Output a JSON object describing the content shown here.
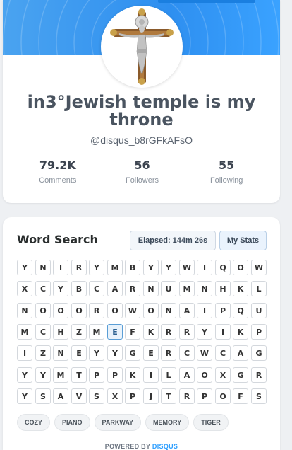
{
  "profile": {
    "display_name": "in3°Jewish temple is my throne",
    "handle": "@disqus_b8rGFkAFsO",
    "stats": [
      {
        "value": "79.2K",
        "label": "Comments"
      },
      {
        "value": "56",
        "label": "Followers"
      },
      {
        "value": "55",
        "label": "Following"
      }
    ]
  },
  "word_search": {
    "title": "Word Search",
    "elapsed": "Elapsed: 144m 26s",
    "my_stats_label": "My Stats",
    "grid": [
      [
        "Y",
        "N",
        "I",
        "R",
        "Y",
        "M",
        "B",
        "Y",
        "Y",
        "W",
        "I",
        "Q",
        "O",
        "W"
      ],
      [
        "X",
        "C",
        "Y",
        "B",
        "C",
        "A",
        "R",
        "N",
        "U",
        "M",
        "N",
        "H",
        "K",
        "L"
      ],
      [
        "N",
        "O",
        "O",
        "O",
        "R",
        "O",
        "W",
        "O",
        "N",
        "A",
        "I",
        "P",
        "Q",
        "U"
      ],
      [
        "M",
        "C",
        "H",
        "Z",
        "M",
        "E",
        "F",
        "K",
        "R",
        "R",
        "Y",
        "I",
        "K",
        "P"
      ],
      [
        "I",
        "Z",
        "N",
        "E",
        "Y",
        "Y",
        "G",
        "E",
        "R",
        "C",
        "W",
        "C",
        "A",
        "G"
      ],
      [
        "Y",
        "Y",
        "M",
        "T",
        "P",
        "P",
        "K",
        "I",
        "L",
        "A",
        "O",
        "X",
        "G",
        "R"
      ],
      [
        "Y",
        "S",
        "A",
        "V",
        "S",
        "X",
        "P",
        "J",
        "T",
        "R",
        "P",
        "O",
        "F",
        "S"
      ]
    ],
    "selected_cell": "E (row 4, column 6)",
    "words": [
      "COZY",
      "PIANO",
      "PARKWAY",
      "MEMORY",
      "TIGER"
    ]
  },
  "footer": {
    "powered_by": "POWERED BY",
    "brand": "DISQUS"
  },
  "colors": {
    "banner": "#2e8ff0",
    "accent": "#2e9fff",
    "selected_cell_border": "#5a9ed6"
  }
}
